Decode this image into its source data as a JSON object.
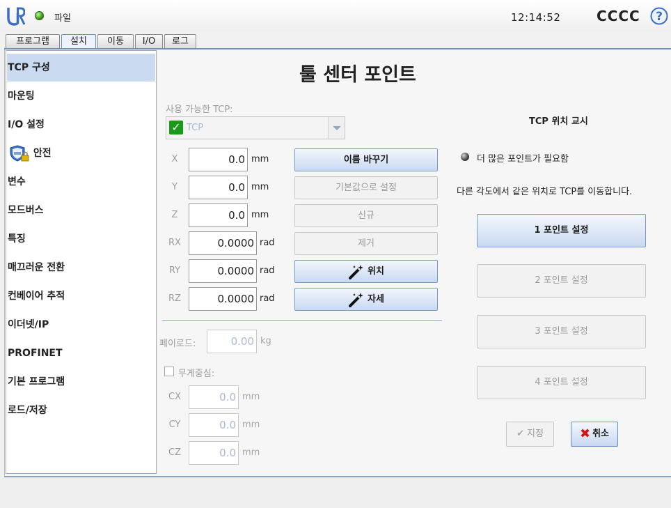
{
  "header": {
    "file_menu": "파일",
    "clock": "12:14:52",
    "robot_name": "CCCC"
  },
  "tabs": [
    {
      "label": "프로그램"
    },
    {
      "label": "설치"
    },
    {
      "label": "이동"
    },
    {
      "label": "I/O"
    },
    {
      "label": "로그"
    }
  ],
  "sidebar": {
    "items": [
      {
        "label": "TCP 구성"
      },
      {
        "label": "마운팅"
      },
      {
        "label": "I/O 설정"
      },
      {
        "label": "안전"
      },
      {
        "label": "변수"
      },
      {
        "label": "모드버스"
      },
      {
        "label": "특징"
      },
      {
        "label": "매끄러운 전환"
      },
      {
        "label": "컨베이어 추적"
      },
      {
        "label": "이더넷/IP"
      },
      {
        "label": "PROFINET"
      },
      {
        "label": "기본 프로그램"
      },
      {
        "label": "로드/저장"
      }
    ]
  },
  "tcp": {
    "title": "툴 센터 포인트",
    "available_label": "사용 가능한 TCP:",
    "selected_tcp": "TCP",
    "fields": [
      {
        "label": "X",
        "value": "0.0",
        "unit": "mm"
      },
      {
        "label": "Y",
        "value": "0.0",
        "unit": "mm"
      },
      {
        "label": "Z",
        "value": "0.0",
        "unit": "mm"
      },
      {
        "label": "RX",
        "value": "0.0000",
        "unit": "rad"
      },
      {
        "label": "RY",
        "value": "0.0000",
        "unit": "rad"
      },
      {
        "label": "RZ",
        "value": "0.0000",
        "unit": "rad"
      }
    ],
    "buttons": {
      "rename": "이름 바꾸기",
      "set_default": "기본값으로 설정",
      "new": "신규",
      "remove": "제거",
      "position": "위치",
      "orientation": "자세"
    },
    "payload": {
      "label": "페이로드:",
      "value": "0.00",
      "unit": "kg"
    },
    "cog": {
      "label": "무게중심:",
      "fields": [
        {
          "label": "CX",
          "value": "0.0",
          "unit": "mm"
        },
        {
          "label": "CY",
          "value": "0.0",
          "unit": "mm"
        },
        {
          "label": "CZ",
          "value": "0.0",
          "unit": "mm"
        }
      ]
    }
  },
  "teach": {
    "title": "TCP 위치 교시",
    "status": "더 많은 포인트가 필요함",
    "instruction": "다른 각도에서 같은 위치로 TCP를 이동합니다.",
    "points": [
      {
        "label": "1 포인트 설정"
      },
      {
        "label": "2 포인트 설정"
      },
      {
        "label": "3 포인트 설정"
      },
      {
        "label": "4 포인트 설정"
      }
    ],
    "ok_label": "지정",
    "cancel_label": "취소"
  },
  "colors": {
    "accent": "#6f8fbf",
    "selection": "#c9daf1",
    "status_green": "#3d9a15",
    "cancel_red": "#d51515"
  }
}
